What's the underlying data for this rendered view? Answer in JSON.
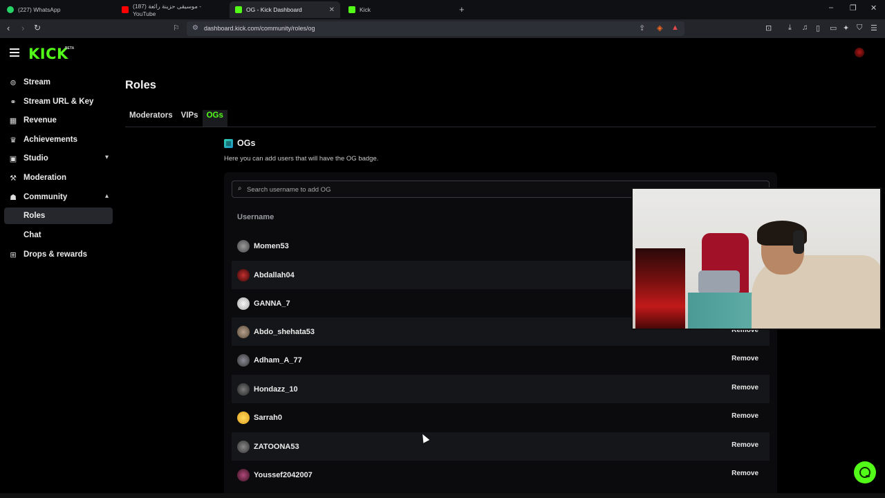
{
  "browser": {
    "tabs": [
      {
        "title": "(227) WhatsApp",
        "favicon_color": "#25d366",
        "active": false
      },
      {
        "title": "(187) موسيقى حزينة رائعة - YouTube",
        "favicon_color": "#ff0000",
        "active": false
      },
      {
        "title": "OG - Kick Dashboard",
        "favicon_color": "#53fc18",
        "active": true
      },
      {
        "title": "Kick",
        "favicon_color": "#53fc18",
        "active": false
      }
    ],
    "new_tab_label": "+",
    "url": "dashboard.kick.com/community/roles/og",
    "window_controls": [
      "–",
      "❐",
      "✕"
    ]
  },
  "app": {
    "logo_text": "KICK",
    "logo_superscript": "BETA",
    "accent_color": "#53fc18"
  },
  "sidebar": {
    "items": [
      {
        "label": "Stream",
        "icon": "broadcast-icon",
        "glyph": "((·))"
      },
      {
        "label": "Stream URL & Key",
        "icon": "link-icon",
        "glyph": "⚭"
      },
      {
        "label": "Revenue",
        "icon": "chart-icon",
        "glyph": "▦"
      },
      {
        "label": "Achievements",
        "icon": "trophy-icon",
        "glyph": "🏆"
      },
      {
        "label": "Studio",
        "icon": "studio-icon",
        "glyph": "▣",
        "chevron": "down"
      },
      {
        "label": "Moderation",
        "icon": "hammer-icon",
        "glyph": "⚒"
      },
      {
        "label": "Community",
        "icon": "community-icon",
        "glyph": "☗",
        "chevron": "up"
      },
      {
        "label": "Roles",
        "sub": true,
        "active": true
      },
      {
        "label": "Chat",
        "sub": true
      },
      {
        "label": "Drops & rewards",
        "icon": "gift-icon",
        "glyph": "🎁"
      }
    ]
  },
  "main": {
    "title": "Roles",
    "tabs": [
      {
        "label": "Moderators",
        "active": false
      },
      {
        "label": "VIPs",
        "active": false
      },
      {
        "label": "OGs",
        "active": true
      }
    ],
    "section": {
      "heading": "OGs",
      "description": "Here you can add users that will have the OG badge."
    },
    "search": {
      "placeholder": "Search username to add OG",
      "value": ""
    },
    "table": {
      "column_header": "Username",
      "remove_label": "Remove",
      "rows": [
        {
          "username": "Momen53",
          "avatar_color": "#6b6b6b"
        },
        {
          "username": "Abdallah04",
          "avatar_color": "#7a1a1a"
        },
        {
          "username": "GANNA_7",
          "avatar_color": "#d8d8d8"
        },
        {
          "username": "Abdo_shehata53",
          "avatar_color": "#8a7a6a"
        },
        {
          "username": "Adham_A_77",
          "avatar_color": "#5a5a66"
        },
        {
          "username": "Hondazz_10",
          "avatar_color": "#4a4a4a"
        },
        {
          "username": "Sarrah0",
          "avatar_color": "#f0c040"
        },
        {
          "username": "ZATOONA53",
          "avatar_color": "#555555"
        },
        {
          "username": "Youssef2042007",
          "avatar_color": "#8a3a5a"
        }
      ]
    }
  }
}
